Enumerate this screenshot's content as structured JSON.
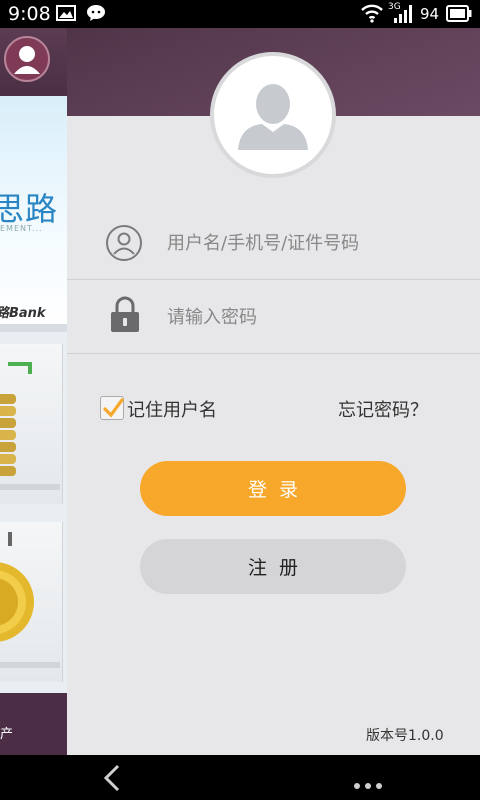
{
  "status_bar": {
    "time": "9:08",
    "network_label": "3G",
    "battery": "94",
    "icons": [
      "image-icon",
      "wechat-icon",
      "wifi-icon",
      "signal-icon",
      "battery-icon"
    ]
  },
  "side_menu": {
    "banner_title": "思路",
    "banner_subtitle": "EMENT...",
    "bank_label": "路Bank",
    "bottom_label": "产"
  },
  "login": {
    "username_placeholder": "用户名/手机号/证件号码",
    "password_placeholder": "请输入密码",
    "remember_label": "记住用户名",
    "remember_checked": true,
    "forgot_label": "忘记密码？",
    "login_button": "登录",
    "register_button": "注册",
    "version": "版本号1.0.0"
  },
  "colors": {
    "accent": "#f7a82a",
    "header": "#5a3c52",
    "panel_bg": "#e7e7ea"
  }
}
